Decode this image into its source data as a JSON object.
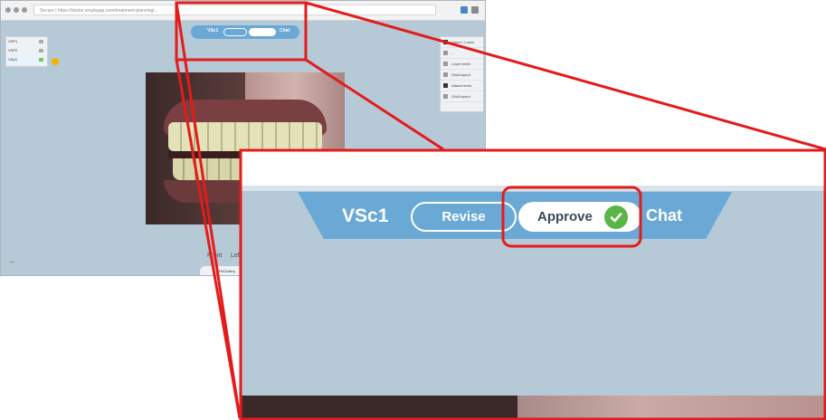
{
  "browser": {
    "url": "Secure | https://doctor.smylegap.com/treatment-planning/..."
  },
  "toolbar": {
    "title": "VSc1",
    "revise_label": "Revise",
    "approve_label": "Approve",
    "chat_label": "Chat"
  },
  "steps": [
    {
      "label": "VSP1"
    },
    {
      "label": "VSP2"
    },
    {
      "label": "VSp3"
    }
  ],
  "right_panel": {
    "items": [
      {
        "label": "Upper / Lower"
      },
      {
        "label": "..."
      },
      {
        "label": "Lower teeth"
      },
      {
        "label": "Grid/Layout"
      },
      {
        "label": "Attachments"
      },
      {
        "label": "Grid/Layout"
      }
    ]
  },
  "views": {
    "front": "Front",
    "left": "Left"
  },
  "fit_tab_label": "Fit/Gallery",
  "colors": {
    "viewport_bg": "#b6c9d6",
    "toolbar_blue": "#6aa9d6",
    "approve_check_green": "#5ab545",
    "highlight_red": "#e31b1b"
  },
  "icons": [
    "check-icon",
    "back-icon",
    "forward-icon",
    "reload-icon",
    "gear-icon"
  ]
}
